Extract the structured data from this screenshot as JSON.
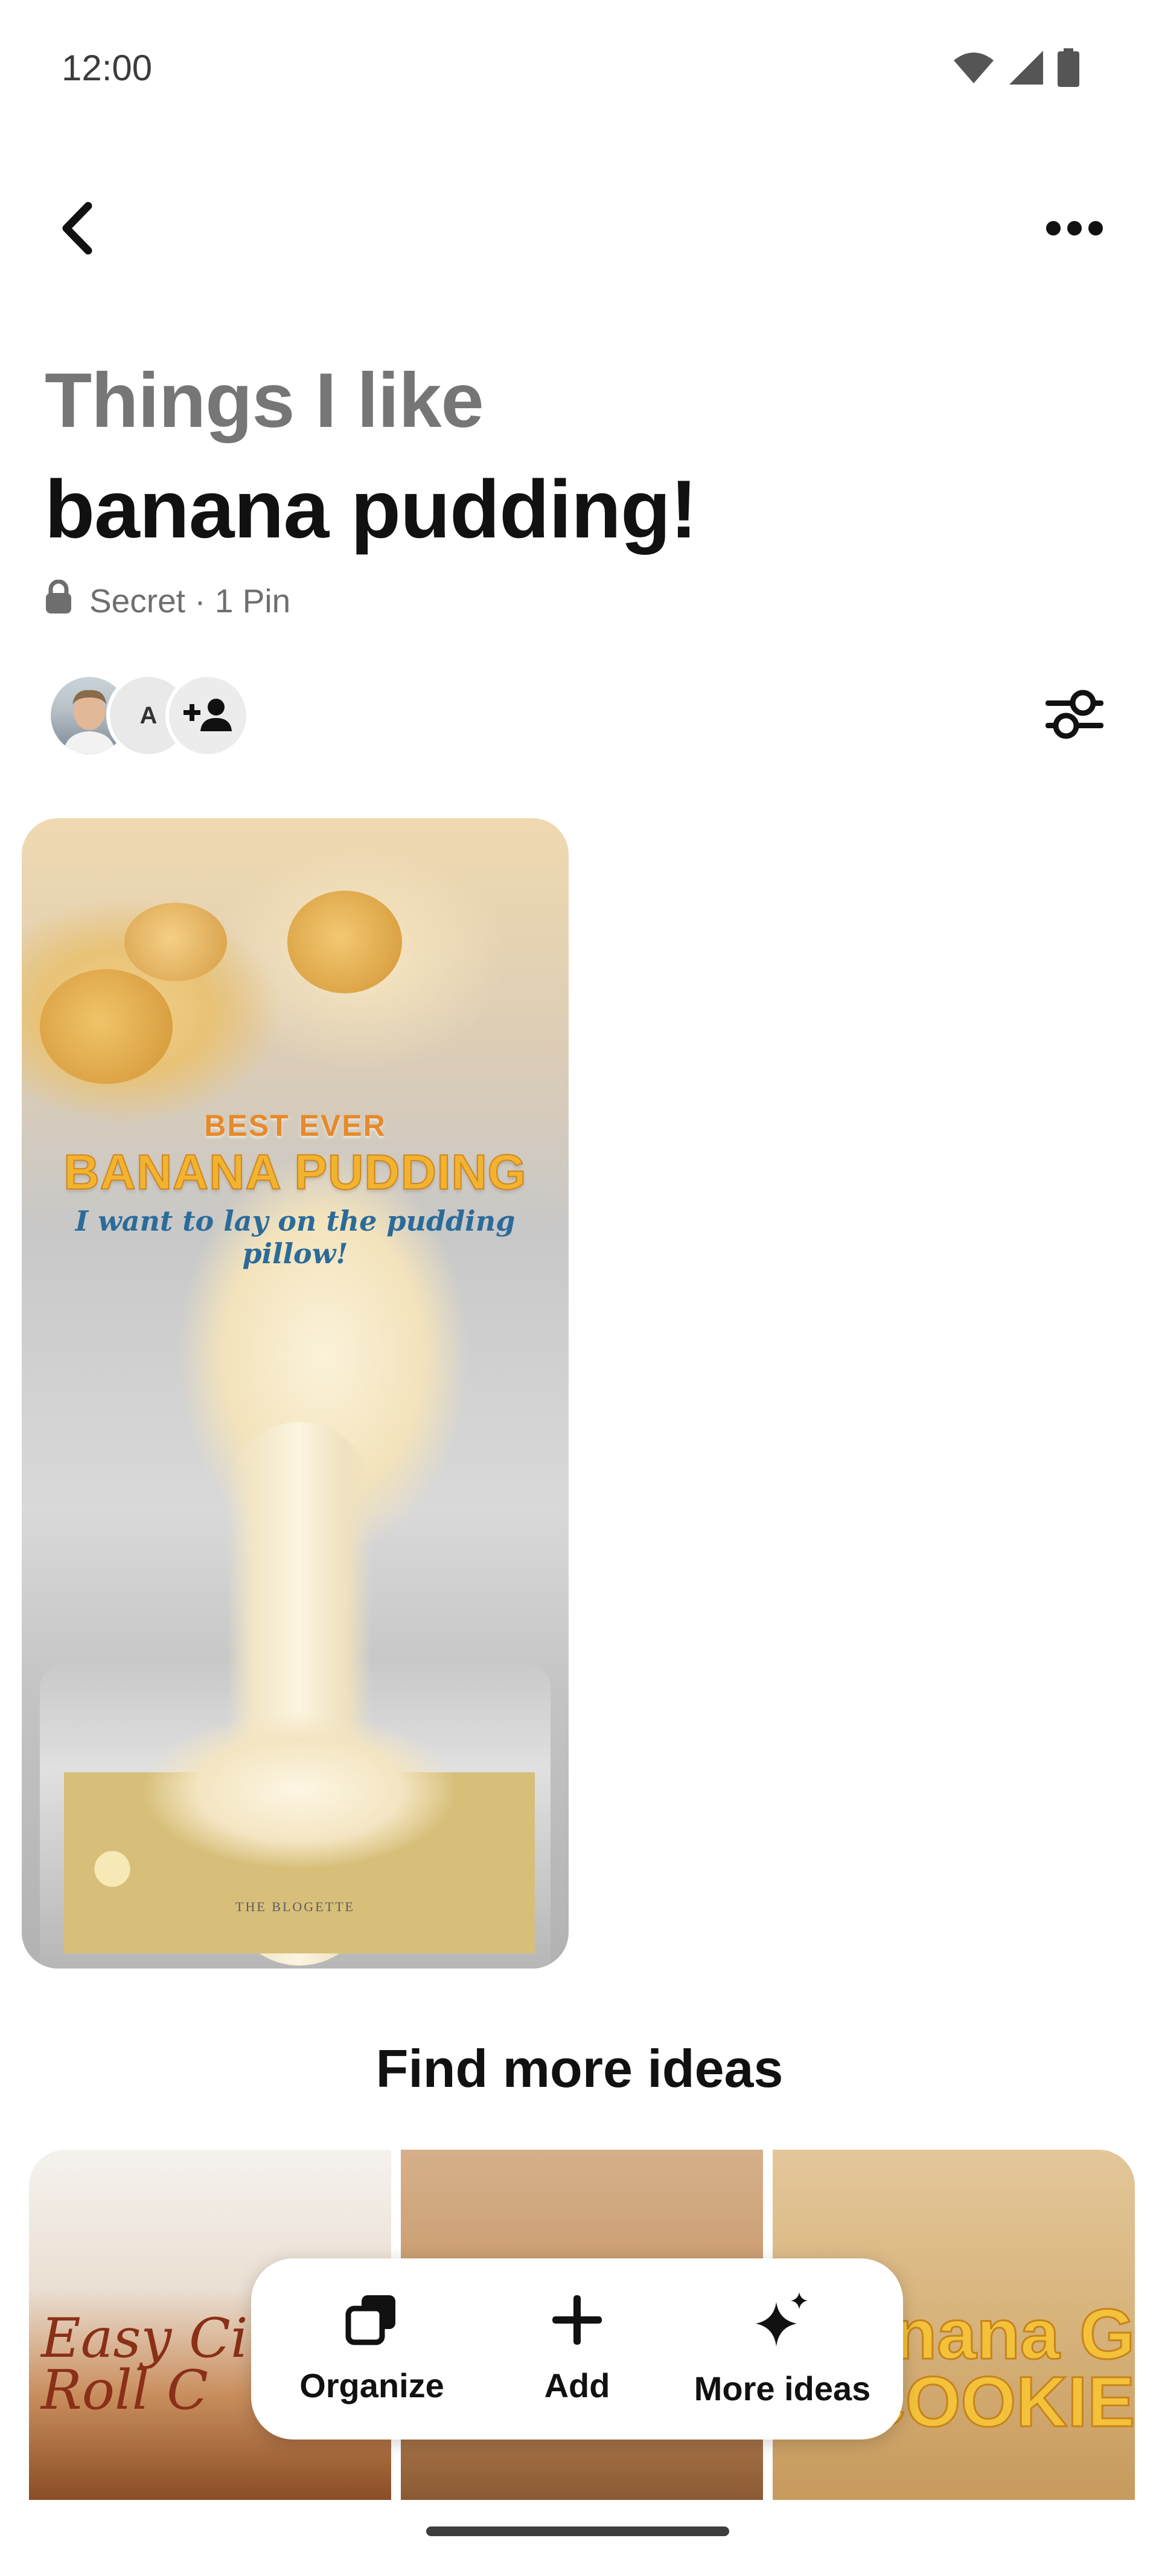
{
  "status_bar": {
    "time": "12:00",
    "icons": [
      "wifi-icon",
      "signal-icon",
      "battery-icon"
    ]
  },
  "top_bar": {
    "back_icon": "chevron-left-icon",
    "more_icon": "ellipsis-icon"
  },
  "board": {
    "parent_name": "Things I like",
    "title": "banana pudding!",
    "privacy": "Secret · 1 Pin",
    "privacy_icon": "lock-icon"
  },
  "collaborators": {
    "avatar_initial": "A",
    "add_icon": "add-person-icon"
  },
  "filter_icon": "sliders-icon",
  "pins": [
    {
      "overlay_line1": "BEST EVER",
      "overlay_line2": "BANANA PUDDING",
      "overlay_line3": "I want to lay on the pudding pillow!",
      "watermark": "THE BLOGETTE"
    }
  ],
  "more_ideas": {
    "title": "Find more ideas",
    "cards": [
      {
        "text": "Easy Cinn Roll C"
      },
      {
        "text": ""
      },
      {
        "text": "nana G COOKIE"
      }
    ]
  },
  "action_bar": {
    "items": [
      {
        "label": "Organize",
        "icon": "organize-icon"
      },
      {
        "label": "Add",
        "icon": "plus-icon"
      },
      {
        "label": "More ideas",
        "icon": "sparkle-icon"
      }
    ]
  },
  "colors": {
    "text_primary": "#111111",
    "text_secondary": "#767676",
    "background": "#ffffff"
  }
}
